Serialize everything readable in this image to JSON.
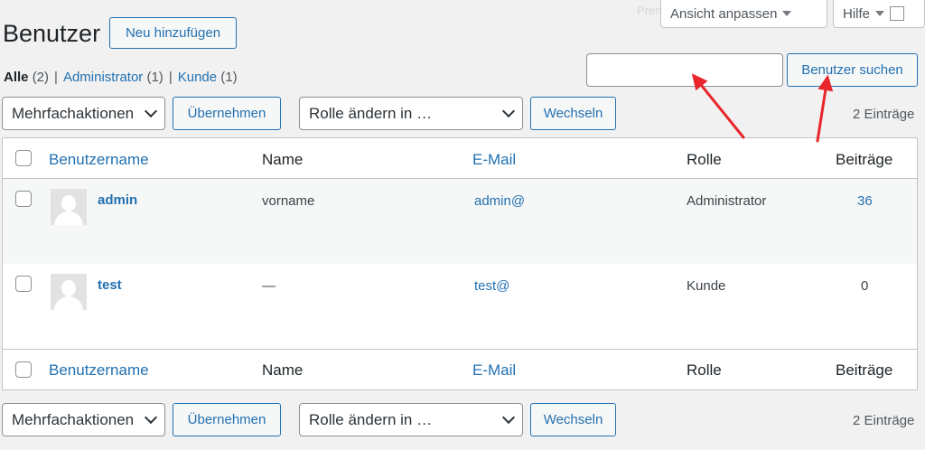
{
  "screen_options": {
    "view_label": "Ansicht anpassen",
    "help_label": "Hilfe",
    "ghost_text": "Prenend..."
  },
  "page": {
    "title": "Benutzer",
    "add_new_label": "Neu hinzufügen"
  },
  "filters": [
    {
      "label": "Alle",
      "count": "(2)"
    },
    {
      "label": "Administrator",
      "count": "(1)"
    },
    {
      "label": "Kunde",
      "count": "(1)"
    }
  ],
  "filter_separator": "|",
  "search": {
    "value": "",
    "button_label": "Benutzer suchen"
  },
  "toolbar": {
    "bulk_actions": "Mehrfachaktionen",
    "apply_label": "Übernehmen",
    "change_role": "Rolle ändern in …",
    "switch_label": "Wechseln",
    "count_text": "2 Einträge"
  },
  "columns": {
    "username": "Benutzername",
    "name": "Name",
    "email": "E-Mail",
    "role": "Rolle",
    "posts": "Beiträge"
  },
  "users": [
    {
      "username": "admin",
      "name": "vorname",
      "email": "admin@",
      "role": "Administrator",
      "posts": "36"
    },
    {
      "username": "test",
      "name": "—",
      "email": "test@",
      "role": "Kunde",
      "posts": "0"
    }
  ],
  "annotation_color": "#e8262b"
}
